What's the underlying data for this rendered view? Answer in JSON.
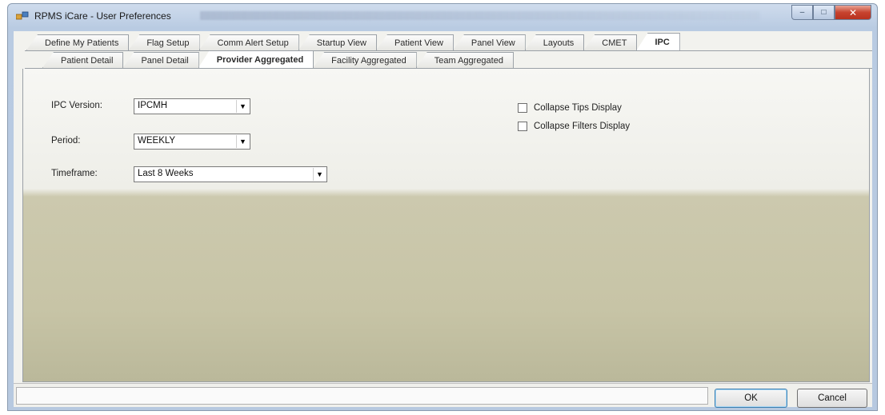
{
  "window": {
    "title": "RPMS iCare - User Preferences",
    "caption_buttons": {
      "minimize": "–",
      "maximize": "□",
      "close": "✕"
    }
  },
  "main_tabs": [
    {
      "label": "Define My Patients"
    },
    {
      "label": "Flag Setup"
    },
    {
      "label": "Comm Alert Setup"
    },
    {
      "label": "Startup View"
    },
    {
      "label": "Patient View"
    },
    {
      "label": "Panel View"
    },
    {
      "label": "Layouts"
    },
    {
      "label": "CMET"
    },
    {
      "label": "IPC",
      "active": true
    }
  ],
  "sub_tabs": [
    {
      "label": "Patient Detail"
    },
    {
      "label": "Panel Detail"
    },
    {
      "label": "Provider Aggregated",
      "active": true
    },
    {
      "label": "Facility Aggregated"
    },
    {
      "label": "Team Aggregated"
    }
  ],
  "form": {
    "ipc_version": {
      "label": "IPC Version:",
      "value": "IPCMH"
    },
    "period": {
      "label": "Period:",
      "value": "WEEKLY"
    },
    "timeframe": {
      "label": "Timeframe:",
      "value": "Last 8 Weeks"
    },
    "collapse_tips": {
      "label": "Collapse Tips Display",
      "checked": false
    },
    "collapse_filters": {
      "label": "Collapse Filters Display",
      "checked": false
    }
  },
  "footer": {
    "ok_label": "OK",
    "cancel_label": "Cancel"
  },
  "colors": {
    "titlebar": "#c3d3e8",
    "close_button": "#c7432f",
    "panel_top": "#f2f2ee",
    "panel_bottom": "#c7c4a6"
  }
}
